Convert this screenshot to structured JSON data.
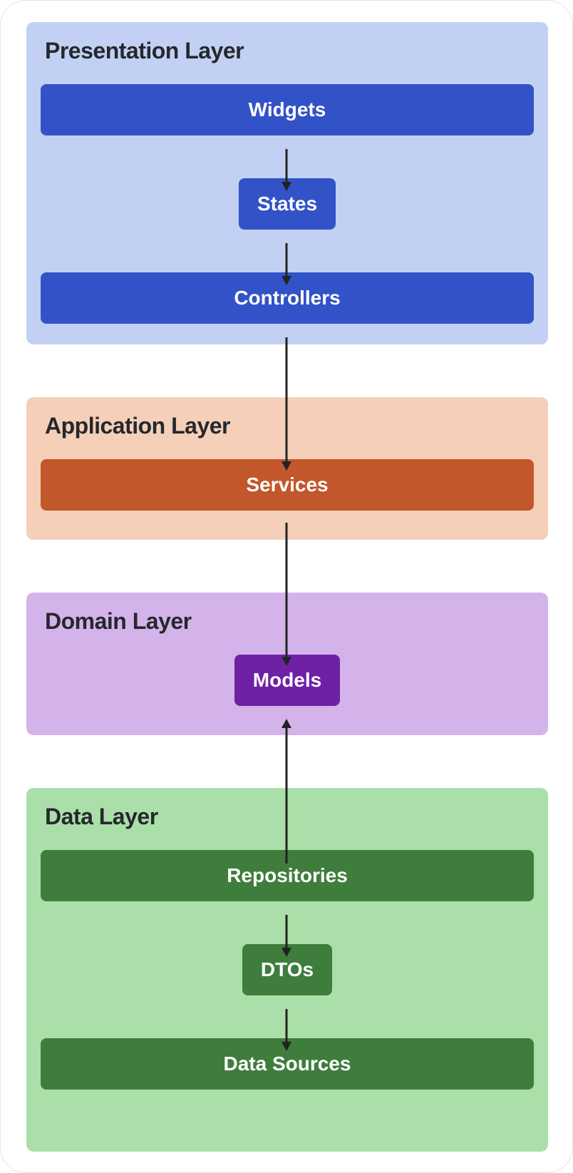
{
  "layers": {
    "presentation": {
      "title": "Presentation Layer",
      "nodes": {
        "widgets": "Widgets",
        "states": "States",
        "controllers": "Controllers"
      }
    },
    "application": {
      "title": "Application Layer",
      "nodes": {
        "services": "Services"
      }
    },
    "domain": {
      "title": "Domain Layer",
      "nodes": {
        "models": "Models"
      }
    },
    "data": {
      "title": "Data Layer",
      "nodes": {
        "repositories": "Repositories",
        "dtos": "DTOs",
        "datasources": "Data Sources"
      }
    }
  },
  "colors": {
    "presentation_bg": "#c2d1f3",
    "presentation_node": "#3252c7",
    "application_bg": "#f5cfb8",
    "application_node": "#c1572a",
    "domain_bg": "#d4b3eb",
    "domain_node": "#6e21a5",
    "data_bg": "#abdfa9",
    "data_node": "#3f7d3d"
  },
  "flow": [
    [
      "widgets",
      "states"
    ],
    [
      "states",
      "controllers"
    ],
    [
      "controllers",
      "services"
    ],
    [
      "services",
      "models"
    ],
    [
      "repositories",
      "models"
    ],
    [
      "repositories",
      "dtos"
    ],
    [
      "dtos",
      "datasources"
    ]
  ]
}
